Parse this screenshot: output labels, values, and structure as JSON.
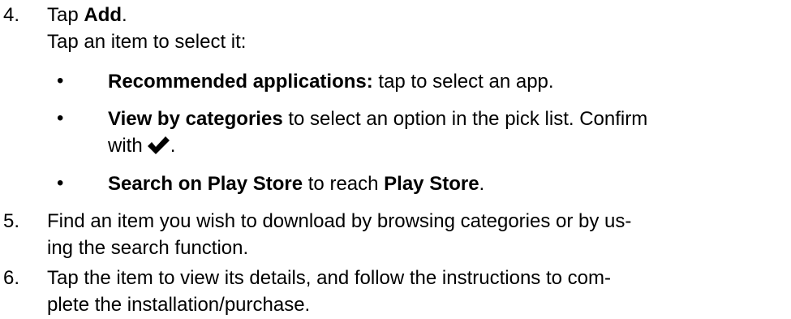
{
  "steps": [
    {
      "number": "4.",
      "title_prefix": "Tap ",
      "title_bold": "Add",
      "title_suffix": ".",
      "intro": "Tap an item to select it:",
      "bullets": [
        {
          "bold": "Recommended applications:",
          "text": " tap to select an app."
        },
        {
          "bold": "View by categories",
          "text_line1": " to select an option in the pick list. Confirm",
          "text_line2": "with",
          "after_icon": ".",
          "icon": "checkmark-icon"
        },
        {
          "bold": "Search on Play Store",
          "text": " to reach ",
          "bold2": "Play Store",
          "end": "."
        }
      ]
    },
    {
      "number": "5.",
      "line1": "Find an item you wish to download by browsing categories or by us-",
      "line2": "ing the search function."
    },
    {
      "number": "6.",
      "line1": "Tap the item to view its details, and follow the instructions to com-",
      "line2": "plete the installation/purchase."
    }
  ]
}
